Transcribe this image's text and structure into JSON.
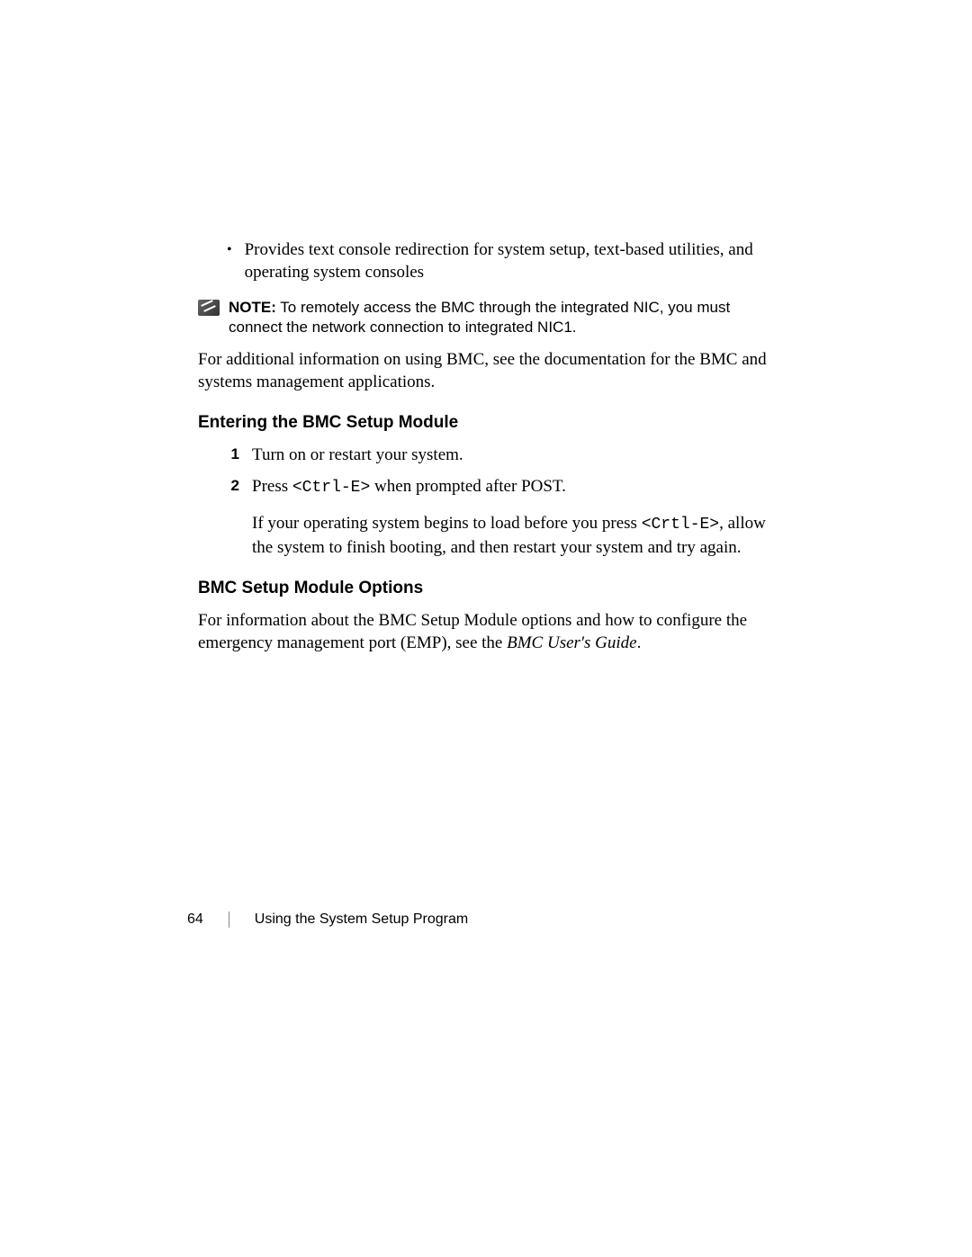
{
  "bullet": {
    "text": "Provides text console redirection for system setup, text-based utilities, and operating system consoles"
  },
  "note": {
    "label": "NOTE:",
    "text_before": " To remotely access the BMC through the ",
    "text_bold": "integrated NIC",
    "text_after": ", you must connect the network connection to integrated NIC1."
  },
  "para1": "For additional information on using BMC, see the documentation for the BMC and systems management applications.",
  "heading1": "Entering the BMC Setup Module",
  "steps": [
    {
      "n": "1",
      "text": "Turn on or restart your system."
    },
    {
      "n": "2",
      "prefix": "Press ",
      "code": "<Ctrl-E>",
      "suffix": " when prompted after POST."
    }
  ],
  "step_note": {
    "prefix": "If your operating system begins to load before you press ",
    "code": "<Crtl-E>",
    "suffix": ", allow the system to finish booting, and then restart your system and try again."
  },
  "heading2": "BMC Setup Module Options",
  "para2_prefix": "For information about the BMC Setup Module options and how to configure the emergency management port (EMP), see the ",
  "para2_italic": "BMC User's Guide",
  "para2_suffix": ".",
  "footer": {
    "page": "64",
    "title": "Using the System Setup Program"
  }
}
